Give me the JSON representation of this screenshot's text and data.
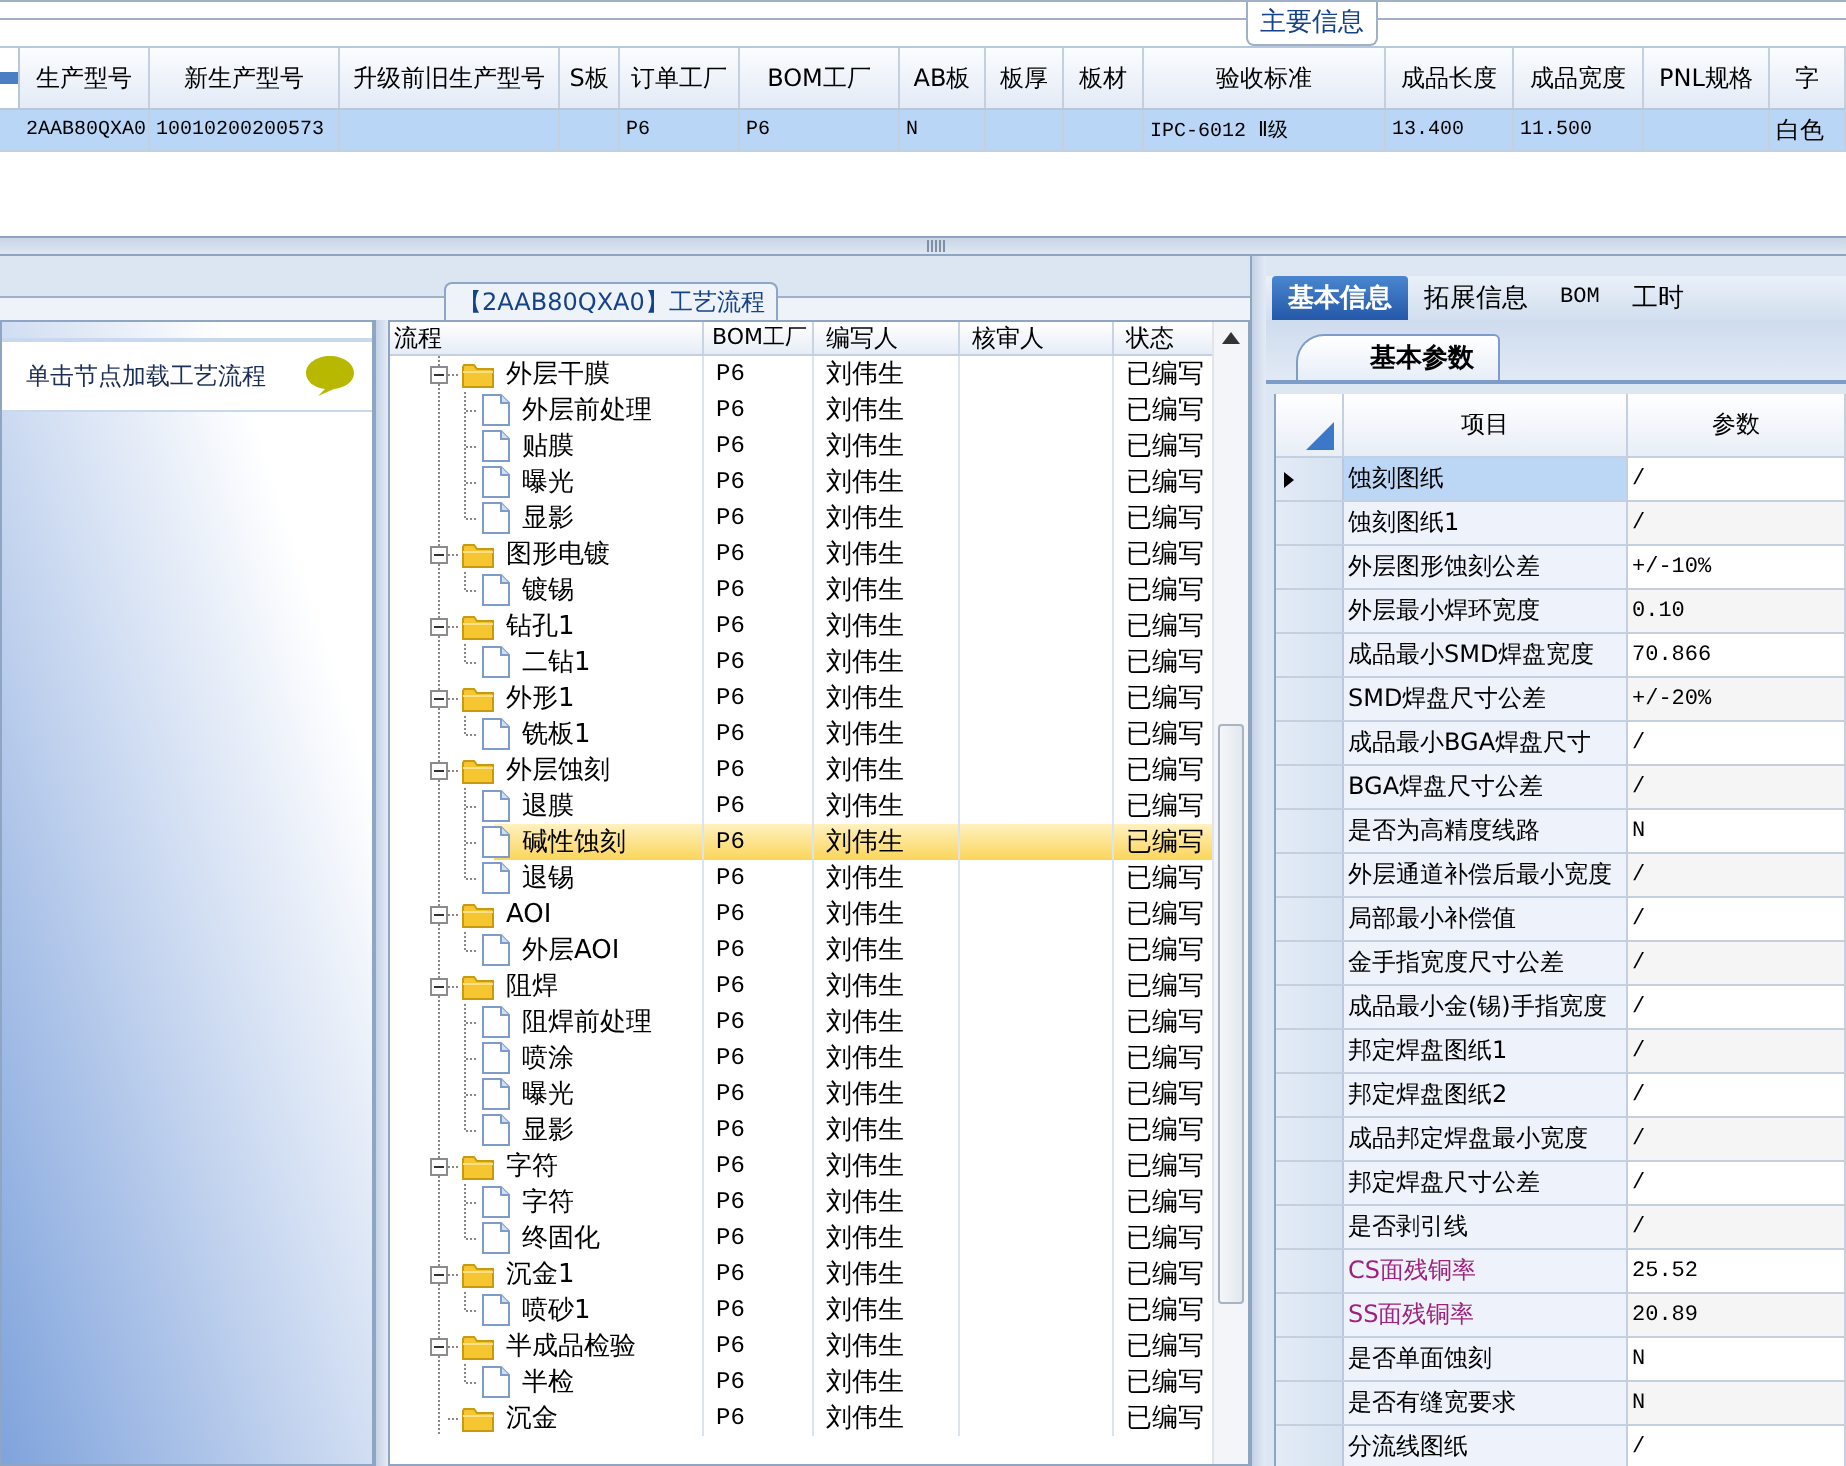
{
  "main_info": {
    "title": "主要信息",
    "selected_row": true,
    "columns": [
      {
        "label": "生产型号",
        "value": "2AAB80QXA0"
      },
      {
        "label": "新生产型号",
        "value": "10010200200573"
      },
      {
        "label": "升级前旧生产型号"
      },
      {
        "label": "S板"
      },
      {
        "label": "订单工厂",
        "value": "P6"
      },
      {
        "label": "BOM工厂",
        "value": "P6"
      },
      {
        "label": "AB板",
        "value": "N"
      },
      {
        "label": "板厚"
      },
      {
        "label": "板材"
      },
      {
        "label": "验收标准",
        "value": "IPC-6012 Ⅱ级"
      },
      {
        "label": "成品长度",
        "value": "13.400"
      },
      {
        "label": "成品宽度",
        "value": "11.500"
      },
      {
        "label": "PNL规格"
      },
      {
        "label": "字",
        "value": "白色"
      }
    ]
  },
  "process": {
    "title": "【2AAB80QXA0】工艺流程",
    "hint": "单击节点加载工艺流程",
    "columns": [
      "流程",
      "BOM工厂",
      "编写人",
      "核审人",
      "状态"
    ],
    "nodes": [
      {
        "name": "外层干膜",
        "bom": "P6",
        "writer": "刘伟生",
        "status": "已编写",
        "selected": false,
        "children": [
          {
            "name": "外层前处理",
            "bom": "P6",
            "writer": "刘伟生",
            "status": "已编写",
            "selected": false
          },
          {
            "name": "贴膜",
            "bom": "P6",
            "writer": "刘伟生",
            "status": "已编写",
            "selected": false
          },
          {
            "name": "曝光",
            "bom": "P6",
            "writer": "刘伟生",
            "status": "已编写",
            "selected": false
          },
          {
            "name": "显影",
            "bom": "P6",
            "writer": "刘伟生",
            "status": "已编写",
            "selected": false
          }
        ]
      },
      {
        "name": "图形电镀",
        "bom": "P6",
        "writer": "刘伟生",
        "status": "已编写",
        "selected": false,
        "children": [
          {
            "name": "镀锡",
            "bom": "P6",
            "writer": "刘伟生",
            "status": "已编写",
            "selected": false
          }
        ]
      },
      {
        "name": "钻孔1",
        "bom": "P6",
        "writer": "刘伟生",
        "status": "已编写",
        "selected": false,
        "children": [
          {
            "name": "二钻1",
            "bom": "P6",
            "writer": "刘伟生",
            "status": "已编写",
            "selected": false
          }
        ]
      },
      {
        "name": "外形1",
        "bom": "P6",
        "writer": "刘伟生",
        "status": "已编写",
        "selected": false,
        "children": [
          {
            "name": "铣板1",
            "bom": "P6",
            "writer": "刘伟生",
            "status": "已编写",
            "selected": false
          }
        ]
      },
      {
        "name": "外层蚀刻",
        "bom": "P6",
        "writer": "刘伟生",
        "status": "已编写",
        "selected": false,
        "children": [
          {
            "name": "退膜",
            "bom": "P6",
            "writer": "刘伟生",
            "status": "已编写",
            "selected": false
          },
          {
            "name": "碱性蚀刻",
            "bom": "P6",
            "writer": "刘伟生",
            "status": "已编写",
            "selected": true
          },
          {
            "name": "退锡",
            "bom": "P6",
            "writer": "刘伟生",
            "status": "已编写",
            "selected": false
          }
        ]
      },
      {
        "name": "AOI",
        "bom": "P6",
        "writer": "刘伟生",
        "status": "已编写",
        "selected": false,
        "children": [
          {
            "name": "外层AOI",
            "bom": "P6",
            "writer": "刘伟生",
            "status": "已编写",
            "selected": false
          }
        ]
      },
      {
        "name": "阻焊",
        "bom": "P6",
        "writer": "刘伟生",
        "status": "已编写",
        "selected": false,
        "children": [
          {
            "name": "阻焊前处理",
            "bom": "P6",
            "writer": "刘伟生",
            "status": "已编写",
            "selected": false
          },
          {
            "name": "喷涂",
            "bom": "P6",
            "writer": "刘伟生",
            "status": "已编写",
            "selected": false
          },
          {
            "name": "曝光",
            "bom": "P6",
            "writer": "刘伟生",
            "status": "已编写",
            "selected": false
          },
          {
            "name": "显影",
            "bom": "P6",
            "writer": "刘伟生",
            "status": "已编写",
            "selected": false
          }
        ]
      },
      {
        "name": "字符",
        "bom": "P6",
        "writer": "刘伟生",
        "status": "已编写",
        "selected": false,
        "children": [
          {
            "name": "字符",
            "bom": "P6",
            "writer": "刘伟生",
            "status": "已编写",
            "selected": false
          },
          {
            "name": "终固化",
            "bom": "P6",
            "writer": "刘伟生",
            "status": "已编写",
            "selected": false
          }
        ]
      },
      {
        "name": "沉金1",
        "bom": "P6",
        "writer": "刘伟生",
        "status": "已编写",
        "selected": false,
        "children": [
          {
            "name": "喷砂1",
            "bom": "P6",
            "writer": "刘伟生",
            "status": "已编写",
            "selected": false
          }
        ]
      },
      {
        "name": "半成品检验",
        "bom": "P6",
        "writer": "刘伟生",
        "status": "已编写",
        "selected": false,
        "children": [
          {
            "name": "半检",
            "bom": "P6",
            "writer": "刘伟生",
            "status": "已编写",
            "selected": false
          }
        ]
      },
      {
        "name": "沉金",
        "bom": "P6",
        "writer": "刘伟生",
        "status": "已编写",
        "selected": false
      }
    ]
  },
  "details": {
    "tabs": [
      {
        "label": "基本信息",
        "selected": true
      },
      {
        "label": "拓展信息",
        "selected": false
      },
      {
        "label": "BOM",
        "selected": false
      },
      {
        "label": "工时",
        "selected": false
      }
    ],
    "subtab": "基本参数",
    "columns": [
      "项目",
      "参数"
    ],
    "rows": [
      {
        "item": "蚀刻图纸",
        "value": "/",
        "color": "#000000",
        "current": true
      },
      {
        "item": "蚀刻图纸1",
        "value": "/",
        "color": "#000000",
        "current": false
      },
      {
        "item": "外层图形蚀刻公差",
        "value": "+/-10%",
        "color": "#000000",
        "current": false
      },
      {
        "item": "外层最小焊环宽度",
        "value": "0.10",
        "color": "#000000",
        "current": false
      },
      {
        "item": "成品最小SMD焊盘宽度",
        "value": "70.866",
        "color": "#000000",
        "current": false
      },
      {
        "item": "SMD焊盘尺寸公差",
        "value": "+/-20%",
        "color": "#000000",
        "current": false
      },
      {
        "item": "成品最小BGA焊盘尺寸",
        "value": "/",
        "color": "#000000",
        "current": false
      },
      {
        "item": "BGA焊盘尺寸公差",
        "value": "/",
        "color": "#000000",
        "current": false
      },
      {
        "item": "是否为高精度线路",
        "value": "N",
        "color": "#000000",
        "current": false
      },
      {
        "item": "外层通道补偿后最小宽度",
        "value": "/",
        "color": "#000000",
        "current": false
      },
      {
        "item": "局部最小补偿值",
        "value": "/",
        "color": "#000000",
        "current": false
      },
      {
        "item": "金手指宽度尺寸公差",
        "value": "/",
        "color": "#000000",
        "current": false
      },
      {
        "item": "成品最小金(锡)手指宽度",
        "value": "/",
        "color": "#000000",
        "current": false
      },
      {
        "item": "邦定焊盘图纸1",
        "value": "/",
        "color": "#000000",
        "current": false
      },
      {
        "item": "邦定焊盘图纸2",
        "value": "/",
        "color": "#000000",
        "current": false
      },
      {
        "item": "成品邦定焊盘最小宽度",
        "value": "/",
        "color": "#000000",
        "current": false
      },
      {
        "item": "邦定焊盘尺寸公差",
        "value": "/",
        "color": "#000000",
        "current": false
      },
      {
        "item": "是否剥引线",
        "value": "/",
        "color": "#000000",
        "current": false
      },
      {
        "item": "CS面残铜率",
        "value": "25.52",
        "color": "#a0207e",
        "current": false
      },
      {
        "item": "SS面残铜率",
        "value": "20.89",
        "color": "#a0207e",
        "current": false
      },
      {
        "item": "是否单面蚀刻",
        "value": "N",
        "color": "#000000",
        "current": false
      },
      {
        "item": "是否有缝宽要求",
        "value": "N",
        "color": "#000000",
        "current": false
      },
      {
        "item": "分流线图纸",
        "value": "/",
        "color": "#000000",
        "current": false
      }
    ]
  }
}
